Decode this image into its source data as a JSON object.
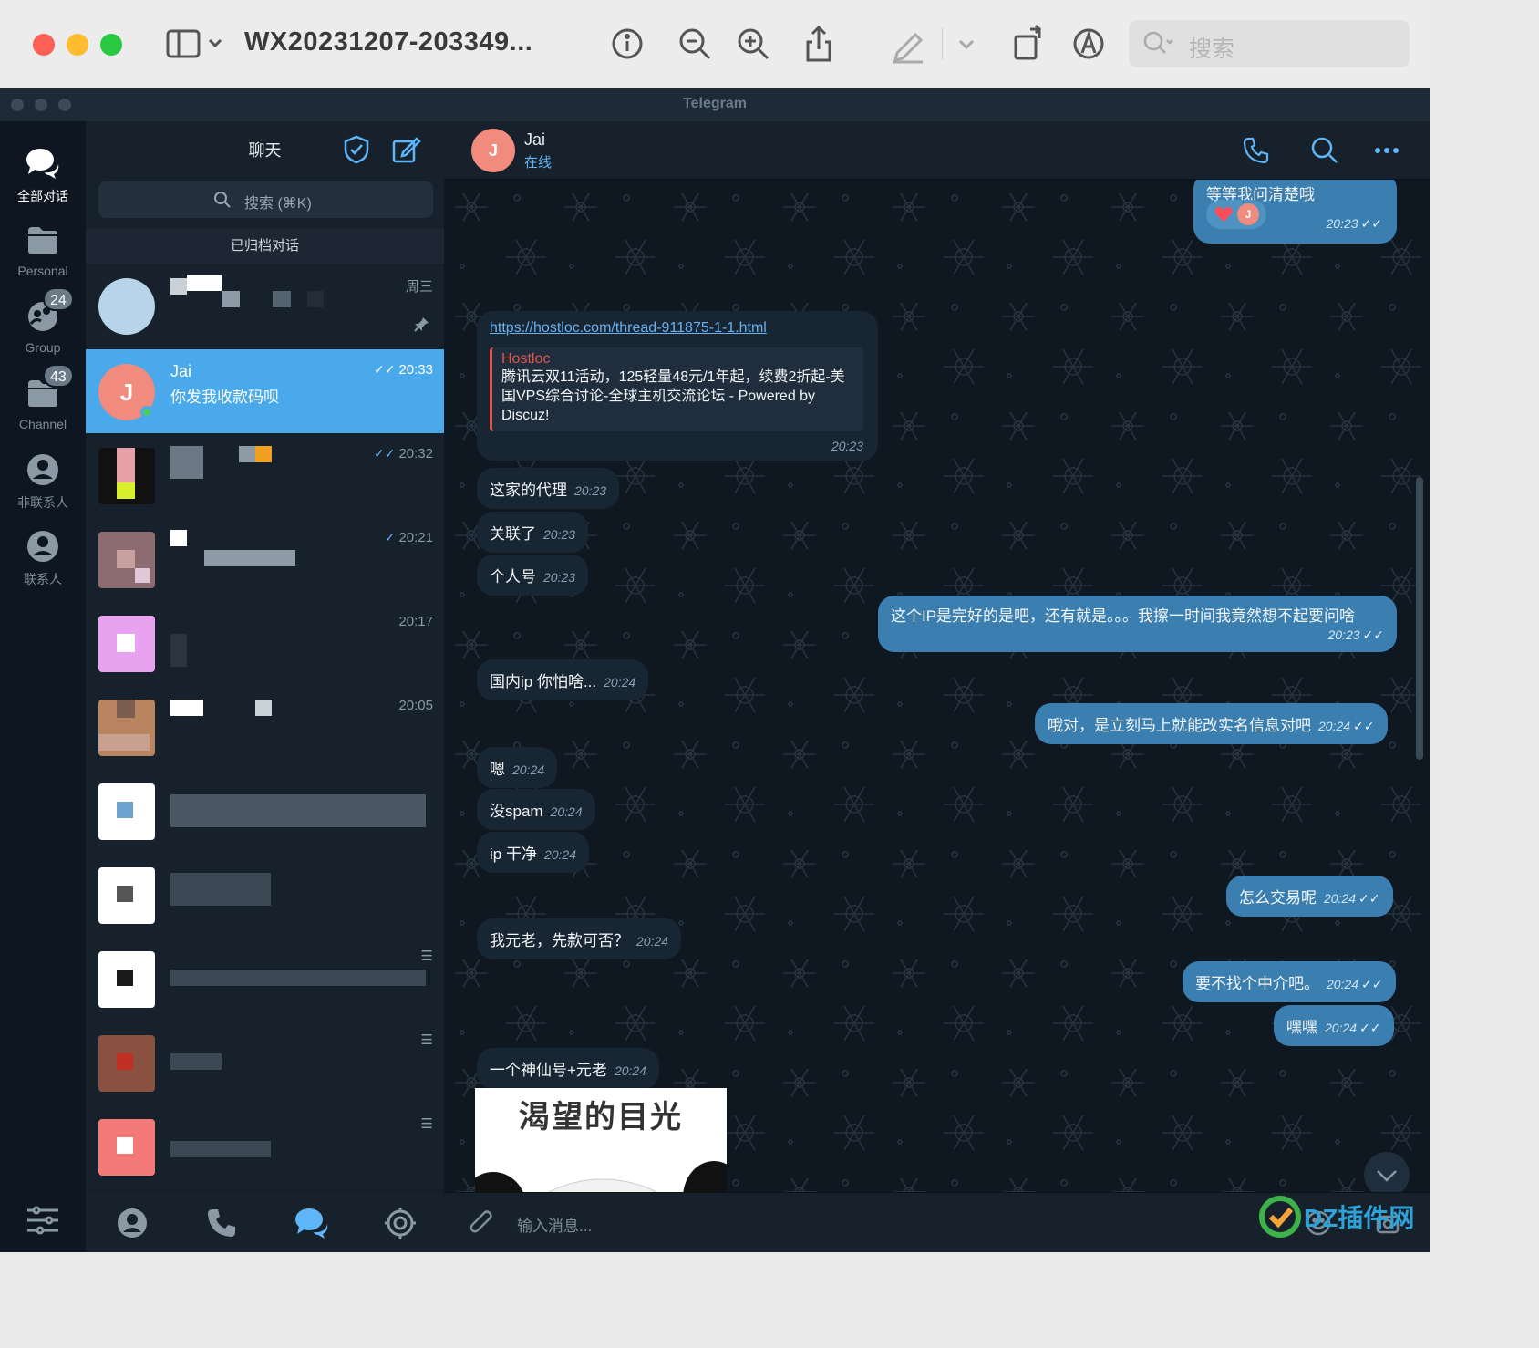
{
  "preview_app": {
    "document_title": "WX20231207-203349...",
    "search_placeholder": "搜索"
  },
  "window": {
    "title": "Telegram"
  },
  "folders": [
    {
      "label": "全部对话",
      "icon": "chats-icon",
      "badge": ""
    },
    {
      "label": "Personal",
      "icon": "folder-icon",
      "badge": ""
    },
    {
      "label": "Group",
      "icon": "group-icon",
      "badge": "24"
    },
    {
      "label": "Channel",
      "icon": "folder-icon",
      "badge": "43"
    },
    {
      "label": "非联系人",
      "icon": "person-icon",
      "badge": ""
    },
    {
      "label": "联系人",
      "icon": "person-icon",
      "badge": ""
    }
  ],
  "chat_list": {
    "title": "聊天",
    "search_placeholder": "搜索 (⌘K)",
    "archived_label": "已归档对话",
    "rows": [
      {
        "name": "",
        "preview": "",
        "time": "周三",
        "read": ""
      },
      {
        "name": "Jai",
        "preview": "你发我收款码呗",
        "time": "20:33",
        "read": "✓✓",
        "avatar_letter": "J"
      },
      {
        "name": "",
        "preview": "",
        "time": "20:32",
        "read": "✓✓"
      },
      {
        "name": "",
        "preview": "",
        "time": "20:21",
        "read": "✓"
      },
      {
        "name": "",
        "preview": "",
        "time": "20:17",
        "read": ""
      },
      {
        "name": "",
        "preview": "",
        "time": "20:05",
        "read": ""
      }
    ]
  },
  "chat": {
    "contact_name": "Jai",
    "contact_status": "在线",
    "avatar_letter": "J",
    "compose_placeholder": "输入消息...",
    "link_message": {
      "url": "https://hostloc.com/thread-911875-1-1.html",
      "site": "Hostloc",
      "text": "腾讯云双11活动，125轻量48元/1年起，续费2折起-美国VPS综合讨论-全球主机交流论坛 - Powered by Discuz!",
      "time": "20:23"
    },
    "messages": [
      {
        "dir": "out",
        "text": "等等我问清楚哦",
        "time": "20:23",
        "check": "✓✓",
        "reaction": "J"
      },
      {
        "dir": "in",
        "text": "这家的代理",
        "time": "20:23"
      },
      {
        "dir": "in",
        "text": "关联了",
        "time": "20:23"
      },
      {
        "dir": "in",
        "text": "个人号",
        "time": "20:23"
      },
      {
        "dir": "out",
        "text": "这个IP是完好的是吧，还有就是。。。我擦一时间我竟然想不起要问啥",
        "time": "20:23",
        "check": "✓✓"
      },
      {
        "dir": "in",
        "text": "国内ip 你怕啥...",
        "time": "20:24"
      },
      {
        "dir": "out",
        "text": "哦对，是立刻马上就能改实名信息对吧",
        "time": "20:24",
        "check": "✓✓"
      },
      {
        "dir": "in",
        "text": "嗯",
        "time": "20:24"
      },
      {
        "dir": "in",
        "text": "没spam",
        "time": "20:24"
      },
      {
        "dir": "in",
        "text": "ip 干净",
        "time": "20:24"
      },
      {
        "dir": "out",
        "text": "怎么交易呢",
        "time": "20:24",
        "check": "✓✓"
      },
      {
        "dir": "in",
        "text": "我元老，先款可否？",
        "time": "20:24"
      },
      {
        "dir": "out",
        "text": "要不找个中介吧。",
        "time": "20:24",
        "check": "✓✓"
      },
      {
        "dir": "out",
        "text": "嘿嘿",
        "time": "20:24",
        "check": "✓✓"
      },
      {
        "dir": "in",
        "text": "一个神仙号+元老",
        "time": "20:24"
      }
    ],
    "sticker_caption": "渴望的目光"
  },
  "watermark": {
    "text": "DZ插件网"
  },
  "colors": {
    "accent": "#5eb5f7",
    "active_row": "#4aa9ea",
    "outgoing_bubble": "#3a7fb0",
    "incoming_bubble": "#182533",
    "avatar_j": "#f08b7e"
  }
}
